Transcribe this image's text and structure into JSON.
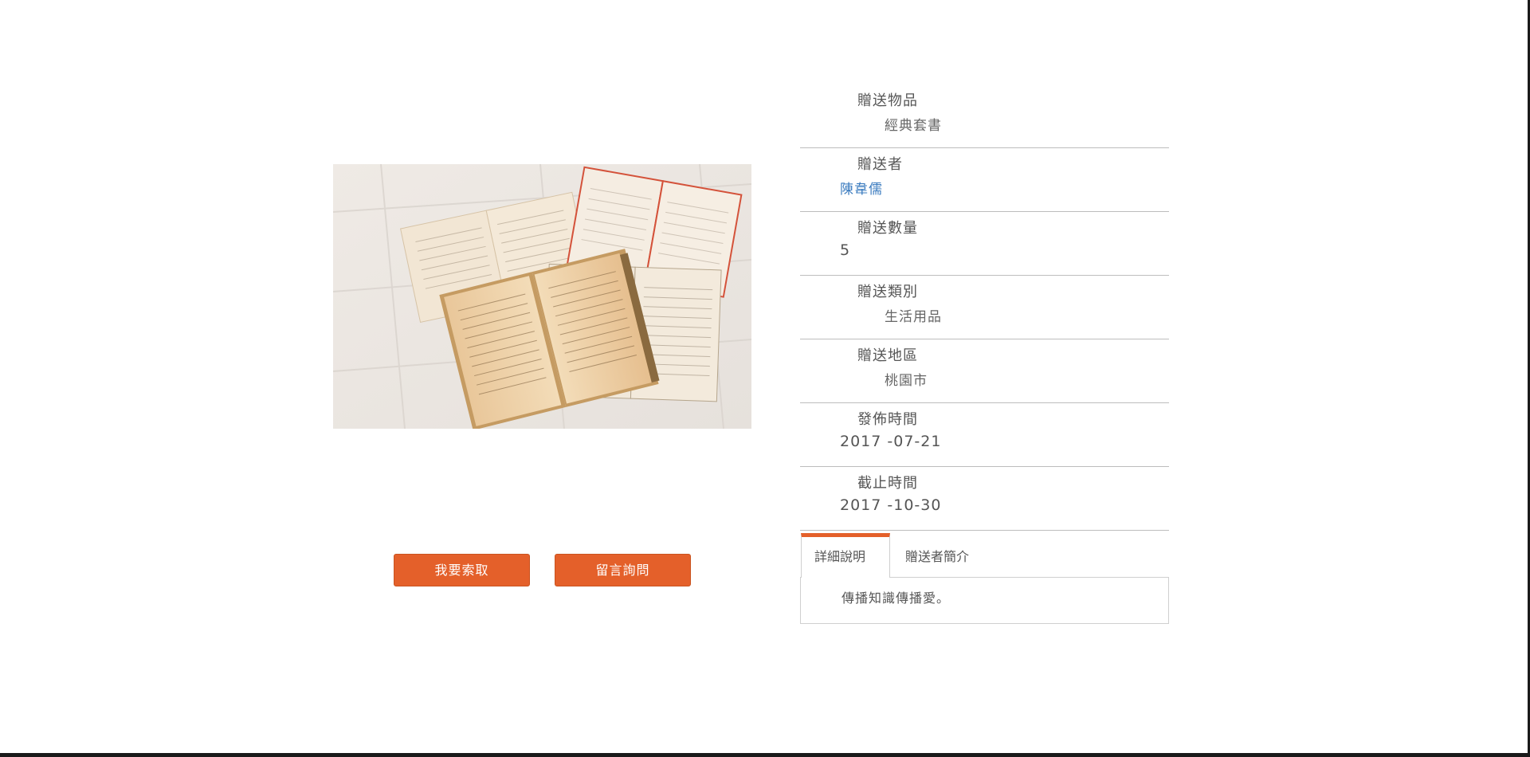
{
  "item": {
    "image_alt": "open old books on white wooden floor",
    "rows": [
      {
        "label": "贈送物品",
        "value": "經典套書"
      },
      {
        "label": "贈送者",
        "value": "陳韋儒"
      },
      {
        "label": "贈送數量",
        "value": "5"
      },
      {
        "label": "贈送類別",
        "value": "生活用品"
      },
      {
        "label": "贈送地區",
        "value": "桃園市"
      },
      {
        "label": "發佈時間",
        "value": "2017 -07-21"
      },
      {
        "label": "截止時間",
        "value": "2017 -10-30"
      }
    ]
  },
  "actions": {
    "claim_label": "我要索取",
    "message_label": "留言詢問"
  },
  "tabs": {
    "detail_label": "詳細說明",
    "giver_label": "贈送者簡介",
    "detail_text": "傳播知識傳播愛。"
  },
  "colors": {
    "accent": "#e4602a",
    "link": "#3a7bbf"
  }
}
